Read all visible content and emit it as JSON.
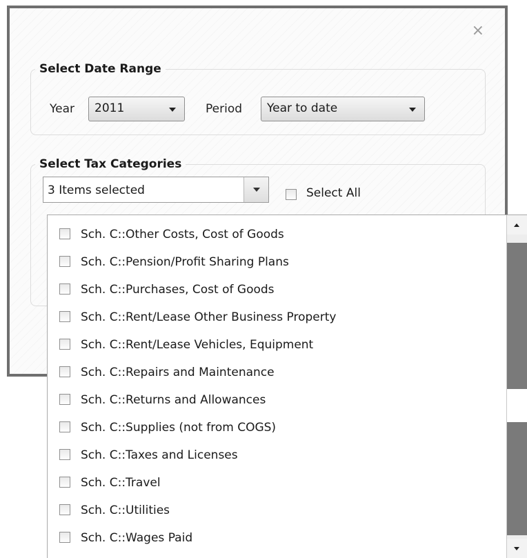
{
  "dialog": {
    "close_icon": "close-icon",
    "close_glyph": "×"
  },
  "date_range": {
    "legend": "Select Date Range",
    "year_label": "Year",
    "year_value": "2011",
    "period_label": "Period",
    "period_value": "Year to date"
  },
  "tax_categories": {
    "legend": "Select Tax Categories",
    "selected_text": "3 Items selected",
    "select_all_label": "Select All",
    "items": [
      {
        "label": "Sch. C::Other Costs, Cost of Goods",
        "checked": false
      },
      {
        "label": "Sch. C::Pension/Profit Sharing Plans",
        "checked": false
      },
      {
        "label": "Sch. C::Purchases, Cost of Goods",
        "checked": false
      },
      {
        "label": "Sch. C::Rent/Lease Other Business Property",
        "checked": false
      },
      {
        "label": "Sch. C::Rent/Lease Vehicles, Equipment",
        "checked": false
      },
      {
        "label": "Sch. C::Repairs and Maintenance",
        "checked": false
      },
      {
        "label": "Sch. C::Returns and Allowances",
        "checked": false
      },
      {
        "label": "Sch. C::Supplies (not from COGS)",
        "checked": false
      },
      {
        "label": "Sch. C::Taxes and Licenses",
        "checked": false
      },
      {
        "label": "Sch. C::Travel",
        "checked": false
      },
      {
        "label": "Sch. C::Utilities",
        "checked": false
      },
      {
        "label": "Sch. C::Wages Paid",
        "checked": false
      }
    ]
  }
}
